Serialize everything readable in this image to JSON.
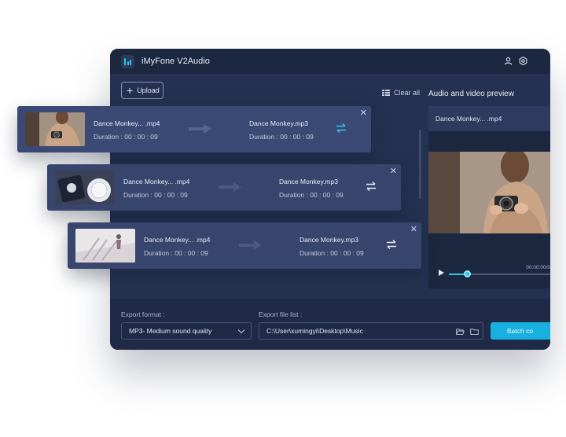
{
  "app": {
    "title": "iMyFone V2Audio"
  },
  "toolbar": {
    "upload_label": "Upload",
    "clear_all_label": "Clear all"
  },
  "files": [
    {
      "source_name": "Dance Monkey... .mp4",
      "source_duration": "Duration : 00 : 00 : 09",
      "output_name": "Dance Monkey.mp3",
      "output_duration": "Duration : 00 : 00 : 09",
      "active": true
    },
    {
      "source_name": "Dance Monkey... .mp4",
      "source_duration": "Duration : 00 : 00 : 09",
      "output_name": "Dance Monkey.mp3",
      "output_duration": "Duration : 00 : 00 : 09",
      "active": false
    },
    {
      "source_name": "Dance Monkey... .mp4",
      "source_duration": "Duration : 00 : 00 : 09",
      "output_name": "Dance Monkey.mp3",
      "output_duration": "Duration : 00 : 00 : 09",
      "active": false
    }
  ],
  "preview": {
    "title": "Audio and video preview",
    "file_name": "Dance Monkey... .mp4",
    "time": "00:00:00/0",
    "progress": 0.18
  },
  "export": {
    "format_label": "Export format :",
    "format_value": "MP3- Medium sound quality",
    "path_label": "Export file list :",
    "path_value": "C:\\User\\xumingyi\\Desktop\\Music",
    "batch_button_label": "Batch co"
  },
  "colors": {
    "accent": "#2cc6e8",
    "window_bg": "#243150",
    "card_bg": "#38456c",
    "titlebar_bg": "#1c2740"
  },
  "icons": [
    "app-logo-icon",
    "user-icon",
    "settings-icon",
    "plus-icon",
    "list-icon",
    "close-icon",
    "arrow-right-icon",
    "swap-icon",
    "play-icon",
    "folder-open-icon",
    "folder-icon",
    "chevron-down-icon"
  ]
}
